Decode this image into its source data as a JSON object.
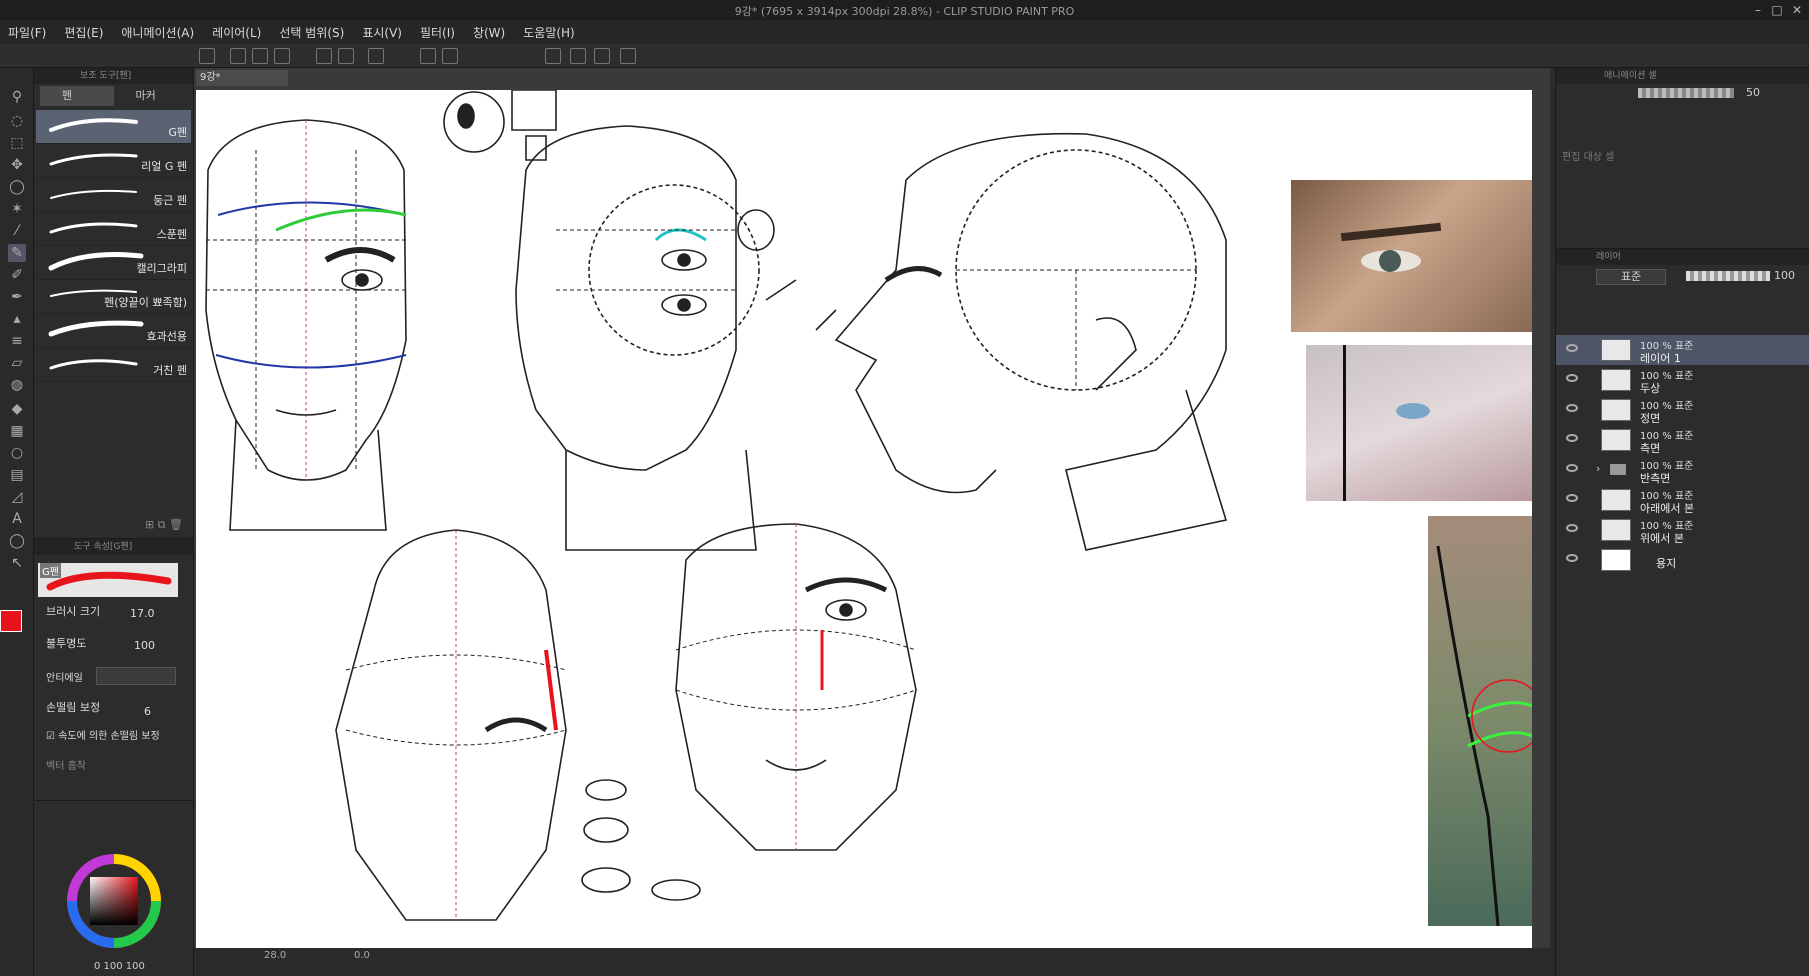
{
  "window": {
    "title": "9강* (7695 x 3914px 300dpi 28.8%)  - CLIP STUDIO PAINT PRO"
  },
  "menu": [
    "파일(F)",
    "편집(E)",
    "애니메이션(A)",
    "레이어(L)",
    "선택 범위(S)",
    "표시(V)",
    "필터(I)",
    "창(W)",
    "도움말(H)"
  ],
  "subtool": {
    "header": "보조 도구[펜]",
    "tabs": [
      "펜",
      "마커"
    ],
    "brushes": [
      "G펜",
      "리얼 G 펜",
      "둥근 펜",
      "스푼펜",
      "캘리그라피",
      "펜(양끝이 뾰족함)",
      "효과선용",
      "거친 펜"
    ],
    "active_brush": "G펜"
  },
  "toolprop": {
    "header": "도구 속성[G펜]",
    "preview_label": "G펜",
    "brush_size_label": "브러시 크기",
    "brush_size": "17.0",
    "opacity_label": "불투명도",
    "opacity": "100",
    "antialias_label": "안티에일",
    "stabilization_label": "손떨림 보정",
    "stabilization": "6",
    "speed_stab_label": "속도에 의한 손떨림 보정",
    "vector_label": "벡터 흡착"
  },
  "color": {
    "main": "#e8141b",
    "sub": "#ffffff",
    "readout": "0 100 100"
  },
  "document": {
    "tab_label": "9강*"
  },
  "statusbar": {
    "zoom": "28.0",
    "angle": "0.0"
  },
  "anim_panel": {
    "header": "애니메이션 셀",
    "opacity": "50",
    "target_label": "편집 대상 셀"
  },
  "layer_panel": {
    "header": "레이어",
    "blend_mode": "표준",
    "opacity": "100",
    "layers": [
      {
        "blend": "100 % 표준",
        "name": "레이어 1",
        "active": true
      },
      {
        "blend": "100 % 표준",
        "name": "두상",
        "active": false
      },
      {
        "blend": "100 % 표준",
        "name": "정면",
        "active": false
      },
      {
        "blend": "100 % 표준",
        "name": "측면",
        "active": false
      },
      {
        "blend": "100 % 표준",
        "name": "반측면",
        "active": false
      },
      {
        "blend": "100 % 표준",
        "name": "아래에서 본",
        "active": false
      },
      {
        "blend": "100 % 표준",
        "name": "위에서 본",
        "active": false
      },
      {
        "blend": "",
        "name": "용지",
        "active": false
      }
    ]
  }
}
